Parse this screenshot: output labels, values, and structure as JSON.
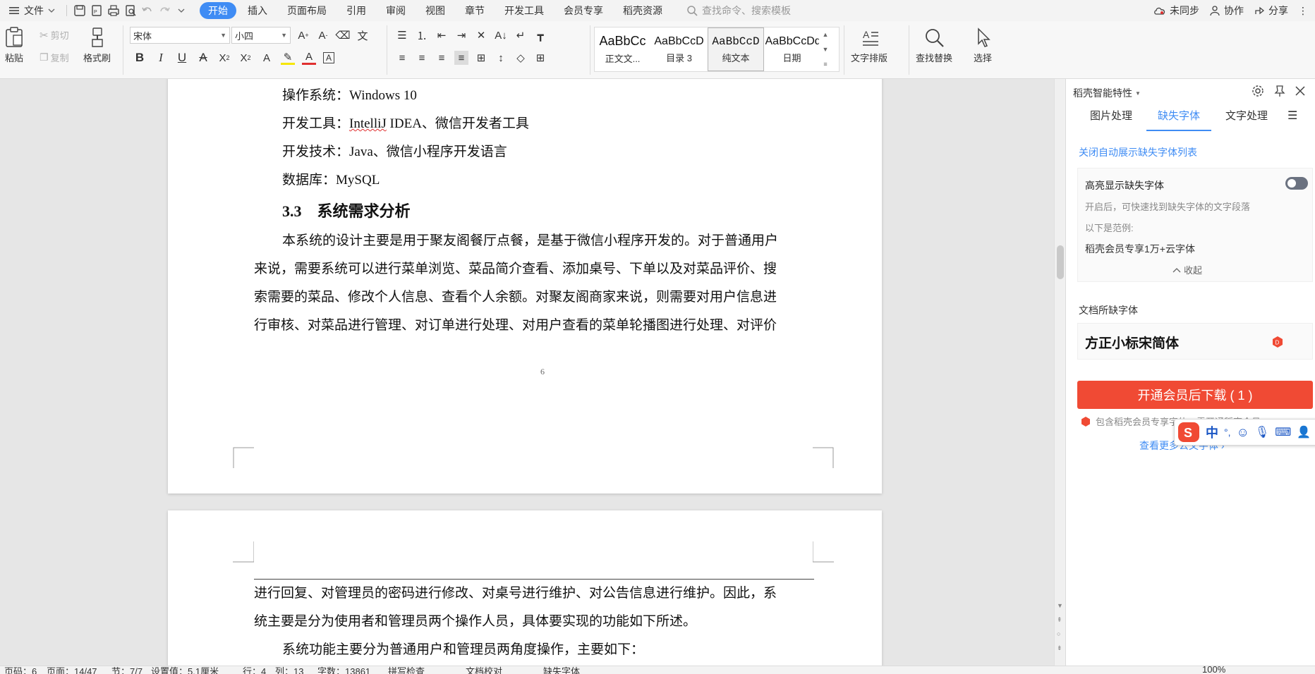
{
  "menubar": {
    "file_label": "文件",
    "tabs": [
      "开始",
      "插入",
      "页面布局",
      "引用",
      "审阅",
      "视图",
      "章节",
      "开发工具",
      "会员专享",
      "稻壳资源"
    ],
    "search_placeholder": "查找命令、搜索模板",
    "sync_label": "未同步",
    "collab_label": "协作",
    "share_label": "分享"
  },
  "ribbon": {
    "paste_label": "粘贴",
    "cut_label": "剪切",
    "copy_label": "复制",
    "format_painter_label": "格式刷",
    "font_name": "宋体",
    "font_size": "小四",
    "styles": [
      {
        "sample": "AaBbCc",
        "name": "正文文..."
      },
      {
        "sample": "AaBbCcD",
        "name": "目录 3"
      },
      {
        "sample": "AaBbCcD",
        "name": "纯文本"
      },
      {
        "sample": "AaBbCcDd",
        "name": "日期"
      }
    ],
    "text_layout_label": "文字排版",
    "find_replace_label": "查找替换",
    "select_label": "选择"
  },
  "document": {
    "page1": {
      "lines": [
        {
          "label": "操作系统：",
          "value": "Windows 10"
        },
        {
          "label": "开发工具：",
          "value_underlined": "IntelliJ",
          "value_rest": " IDEA、微信开发者工具"
        },
        {
          "label": "开发技术：",
          "value": "Java、微信小程序开发语言"
        },
        {
          "label": "数据库：",
          "value": "MySQL"
        }
      ],
      "heading_number": "3.3",
      "heading_text": "系统需求分析",
      "para_lines": [
        "本系统的设计主要是用于聚友阁餐厅点餐，是基于微信小程序开发的。对于普通用户",
        "来说，需要系统可以进行菜单浏览、菜品简介查看、添加桌号、下单以及对菜品评价、搜",
        "索需要的菜品、修改个人信息、查看个人余额。对聚友阁商家来说，则需要对用户信息进",
        "行审核、对菜品进行管理、对订单进行处理、对用户查看的菜单轮播图进行处理、对评价"
      ],
      "page_number": "6"
    },
    "page2": {
      "para_lines": [
        "进行回复、对管理员的密码进行修改、对桌号进行维护、对公告信息进行维护。因此，系",
        "统主要是分为使用者和管理员两个操作人员，具体要实现的功能如下所述。",
        "系统功能主要分为普通用户和管理员两角度操作，主要如下："
      ]
    }
  },
  "side_panel": {
    "title": "稻壳智能特性",
    "tabs": [
      "图片处理",
      "缺失字体",
      "文字处理"
    ],
    "active_tab": "缺失字体",
    "close_auto_link": "关闭自动展示缺失字体列表",
    "highlight_title": "高亮显示缺失字体",
    "highlight_desc": "开启后，可快速找到缺失字体的文字段落",
    "example_label": "以下是范例:",
    "example_text": "稻壳会员专享1万+云字体",
    "collapse_label": "收起",
    "missing_fonts_heading": "文档所缺字体",
    "missing_font": "方正小标宋简体",
    "download_button": "开通会员后下载 ( 1 )",
    "promo_text": "包含稻壳会员专享字体，需开通稻壳会员",
    "more_fonts_link": "查看更多公文字体",
    "ime_label": "中"
  },
  "statusbar": {
    "page": "页码：6",
    "pages": "页面：14/47",
    "section": "节：7/7",
    "setting": "设置值：5.1厘米",
    "row": "行：4",
    "col": "列：13",
    "wordcount": "字数：13861",
    "spellcheck": "拼写检查",
    "doc_check": "文档校对",
    "missing_font": "缺失字体",
    "zoom": "100%"
  },
  "colors": {
    "accent": "#3f8cf4",
    "download_button": "#f04a34",
    "spell_error": "#e03030"
  }
}
